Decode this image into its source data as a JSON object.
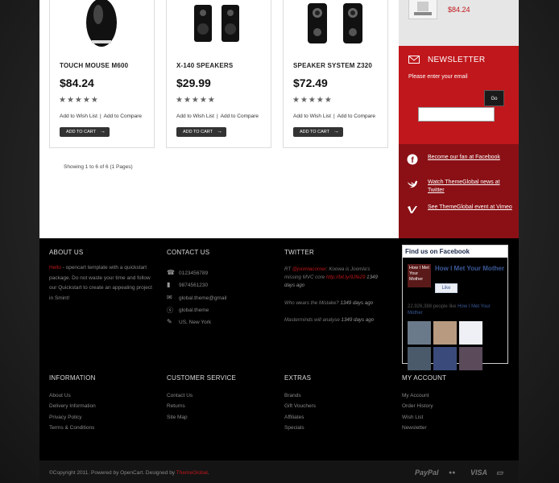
{
  "products": [
    {
      "name": "TOUCH MOUSE M600",
      "price": "$84.24",
      "stars": "★★★★★",
      "wishlist": "Add to Wish List",
      "compare": "Add to Compare",
      "cart": "ADD TO CART",
      "icon": "mouse-icon"
    },
    {
      "name": "X-140 SPEAKERS",
      "price": "$29.99",
      "stars": "★★★★★",
      "wishlist": "Add to Wish List",
      "compare": "Add to Compare",
      "cart": "ADD TO CART",
      "icon": "speakers-icon"
    },
    {
      "name": "SPEAKER SYSTEM Z320",
      "price": "$72.49",
      "stars": "★★★★★",
      "wishlist": "Add to Wish List",
      "compare": "Add to Compare",
      "cart": "ADD TO CART",
      "icon": "speaker-system-icon"
    }
  ],
  "showing": "Showing 1 to 6 of 6 (1 Pages)",
  "sidebar": {
    "top_price": "$84.24",
    "newsletter": {
      "title": "NEWSLETTER",
      "text": "Please enter your email",
      "go": "Go",
      "input_value": ""
    },
    "social": [
      {
        "icon": "facebook-icon",
        "glyph": "f",
        "text": "Become our fan at Facebook"
      },
      {
        "icon": "twitter-icon",
        "glyph": "t",
        "text": "Watch ThemeGlobal news at Twitter"
      },
      {
        "icon": "vimeo-icon",
        "glyph": "v",
        "text": "See ThemeGlobal event at Vimeo"
      }
    ]
  },
  "footer": {
    "about": {
      "title": "ABOUT US",
      "hello": "Hello",
      "text": " - opencart template with a quickstart package. Do not waste your time and follow our Quickstart to create an appealing project in Smint!"
    },
    "contact": {
      "title": "CONTACT US",
      "items": [
        {
          "icon": "phone-icon",
          "glyph": "☎",
          "text": "0123456789"
        },
        {
          "icon": "mobile-icon",
          "glyph": "▮",
          "text": "9874561230"
        },
        {
          "icon": "mail-icon",
          "glyph": "✉",
          "text": "global.theme@gmail"
        },
        {
          "icon": "skype-icon",
          "glyph": "ⓢ",
          "text": "global.theme"
        },
        {
          "icon": "pen-icon",
          "glyph": "✎",
          "text": "US, New York"
        }
      ]
    },
    "twitter": {
      "title": "TWITTER",
      "tweets": [
        {
          "pre": "RT ",
          "mention": "@joomlacorner",
          "mid": ": Koowa is Joomla's missing MVC core ",
          "link": "http://bit.ly/9Jfe29",
          "time": "1349 days ago"
        },
        {
          "pre": "Who wears the Mistake?",
          "mention": "",
          "mid": "",
          "link": "",
          "time": "1349 days ago"
        },
        {
          "pre": "Masterminds will analyse",
          "mention": "",
          "mid": "",
          "link": "",
          "time": "1349 days ago"
        }
      ]
    },
    "facebook": {
      "title": "Find us on Facebook",
      "poster": "How I Met Your Mother",
      "page_name": "How I Met Your Mother",
      "like": "Like",
      "count": "22,926,388 people like ",
      "count_page": "How I Met Your Mother"
    },
    "columns": [
      {
        "title": "INFORMATION",
        "links": [
          "About Us",
          "Delivery Information",
          "Privacy Policy",
          "Terms & Conditions"
        ]
      },
      {
        "title": "CUSTOMER SERVICE",
        "links": [
          "Contact Us",
          "Returns",
          "Site Map"
        ]
      },
      {
        "title": "EXTRAS",
        "links": [
          "Brands",
          "Gift Vouchers",
          "Affiliates",
          "Specials"
        ]
      },
      {
        "title": "MY ACCOUNT",
        "links": [
          "My Account",
          "Order History",
          "Wish List",
          "Newsletter"
        ]
      }
    ],
    "copyright_pre": "©Copyright 2011. Powered by OpenCart.  Designed by ",
    "copyright_brand": "ThemeGlobal",
    "copyright_end": ".",
    "payments": [
      "PayPal",
      "●●",
      "VISA",
      "▭"
    ]
  },
  "colors": {
    "accent": "#c0171c",
    "sidebar_dark": "#8a1015",
    "footer": "#000000"
  }
}
